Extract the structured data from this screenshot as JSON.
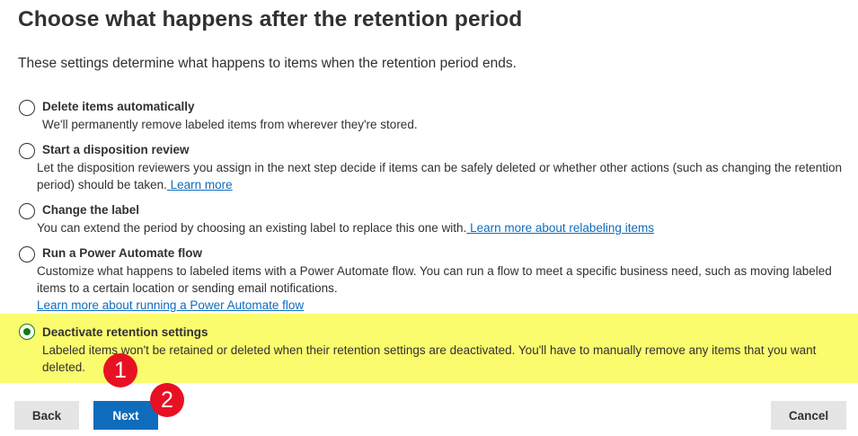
{
  "page": {
    "title": "Choose what happens after the retention period",
    "subtitle": "These settings determine what happens to items when the retention period ends."
  },
  "options": [
    {
      "label": "Delete items automatically",
      "description": "We'll permanently remove labeled items from wherever they're stored.",
      "selected": false
    },
    {
      "label": "Start a disposition review",
      "description": "Let the disposition reviewers you assign in the next step decide if items can be safely deleted or whether other actions (such as changing the retention period) should be taken.",
      "link": " Learn more",
      "selected": false
    },
    {
      "label": "Change the label",
      "description": "You can extend the period by choosing an existing label to replace this one with.",
      "link": " Learn more about relabeling items",
      "selected": false
    },
    {
      "label": "Run a Power Automate flow",
      "description": "Customize what happens to labeled items with a Power Automate flow. You can run a flow to meet a specific business need, such as moving labeled items to a certain location or sending email notifications.",
      "link": "Learn more about running a Power Automate flow",
      "selected": false
    },
    {
      "label": "Deactivate retention settings",
      "description": "Labeled items won't be retained or deleted when their retention settings are deactivated. You'll have to manually remove any items that you want deleted.",
      "selected": true
    }
  ],
  "buttons": {
    "back": "Back",
    "next": "Next",
    "cancel": "Cancel"
  },
  "annotations": {
    "marker_1": "1",
    "marker_2": "2"
  },
  "colors": {
    "highlight": "#fbfb6e",
    "primary": "#0f6cbd",
    "selected_radio": "#107c10",
    "marker": "#e81123"
  }
}
